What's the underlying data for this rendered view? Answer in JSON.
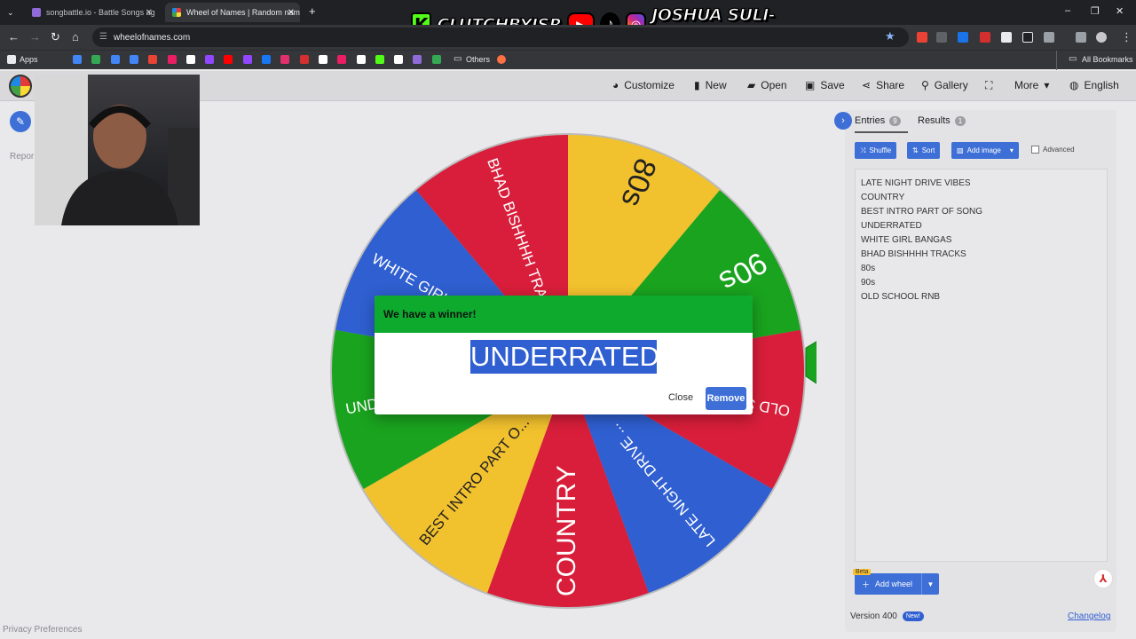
{
  "browser": {
    "tabs": [
      {
        "title": "songbattle.io - Battle Songs ag",
        "active": false,
        "favicon_color": "#8e6bd8"
      },
      {
        "title": "Wheel of Names | Random nam",
        "active": true,
        "favicon_color": "#e53935"
      }
    ],
    "new_tab_label": "+",
    "url": "wheelofnames.com",
    "bookmarks": {
      "apps_label": "Apps",
      "others_label": "Others",
      "all_bookmarks_label": "All Bookmarks",
      "icon_colors": [
        "#4285f4",
        "#34a853",
        "#4285f4",
        "#4285f4",
        "#ea4335",
        "#e91e63",
        "#ffffff",
        "#9146ff",
        "#ff0000",
        "#9146ff",
        "#1877f2",
        "#e1306c",
        "#d32f2f",
        "#ffffff",
        "#e91e63",
        "#ffffff",
        "#53fc18",
        "#ffffff",
        "#8e6bd8",
        "#34a853"
      ]
    }
  },
  "overlay": {
    "kick_letter": "K",
    "handle_1": "CLUTCHBYJSR",
    "handle_2": "JOSHUA SULI-RUKA"
  },
  "appbar": {
    "customize": "Customize",
    "new": "New",
    "open": "Open",
    "save": "Save",
    "share": "Share",
    "gallery": "Gallery",
    "more": "More",
    "language": "English"
  },
  "left": {
    "report_label": "Repor",
    "privacy_label": "Privacy Preferences"
  },
  "wheel": {
    "segments": [
      {
        "label": "COUNTRY",
        "color": "#d81e3a"
      },
      {
        "label": "BEST INTRO PART O...",
        "color": "#f2c12e"
      },
      {
        "label": "UNDERRATED",
        "color": "#1aa31f"
      },
      {
        "label": "WHITE GIRL BANGAS",
        "color": "#2f5fd0"
      },
      {
        "label": "BHAD BISHHHH TRAC...",
        "color": "#d81e3a"
      },
      {
        "label": "80s",
        "color": "#f2c12e"
      },
      {
        "label": "90s",
        "color": "#1aa31f"
      },
      {
        "label": "OLD SCHOOL RNB",
        "color": "#d81e3a"
      },
      {
        "label": "LATE NIGHT DRIVE ...",
        "color": "#2f5fd0"
      }
    ],
    "pointer_color": "#1aa31f"
  },
  "dialog": {
    "title": "We have a winner!",
    "winner": "UNDERRATED",
    "close_label": "Close",
    "remove_label": "Remove"
  },
  "panel": {
    "entries_tab": "Entries",
    "entries_count": "9",
    "results_tab": "Results",
    "results_count": "1",
    "shuffle_label": "Shuffle",
    "sort_label": "Sort",
    "add_image_label": "Add image",
    "advanced_label": "Advanced",
    "entries": [
      "LATE NIGHT DRIVE VIBES",
      "COUNTRY",
      "BEST INTRO PART OF SONG",
      "UNDERRATED",
      "WHITE GIRL BANGAS",
      "BHAD BISHHHH TRACKS",
      "80s",
      "90s",
      "OLD SCHOOL RNB"
    ],
    "beta_label": "Beta",
    "add_wheel_label": "Add wheel",
    "version_label": "Version 400",
    "new_badge": "New!",
    "changelog_label": "Changelog"
  }
}
